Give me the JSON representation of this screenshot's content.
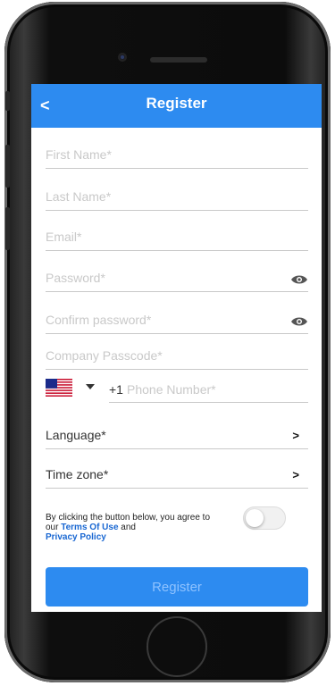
{
  "header": {
    "back_icon": "<",
    "title": "Register"
  },
  "form": {
    "first_name_placeholder": "First Name*",
    "last_name_placeholder": "Last Name*",
    "email_placeholder": "Email*",
    "password_placeholder": "Password*",
    "confirm_password_placeholder": "Confirm password*",
    "company_passcode_placeholder": "Company Passcode*",
    "phone": {
      "country_flag": "us-flag",
      "dial_code": "+1",
      "placeholder": "Phone Number*"
    },
    "language_label": "Language*",
    "timezone_label": "Time zone*",
    "chevron": ">"
  },
  "terms": {
    "text_1": "By clicking the button below, you agree to our ",
    "terms_link": "Terms Of Use",
    "text_2": " and ",
    "privacy_link": "Privacy Policy",
    "toggle_on": false
  },
  "register_button_label": "Register",
  "colors": {
    "accent": "#2d8bf0",
    "link": "#1967d2",
    "placeholder": "#c9c9c9"
  }
}
